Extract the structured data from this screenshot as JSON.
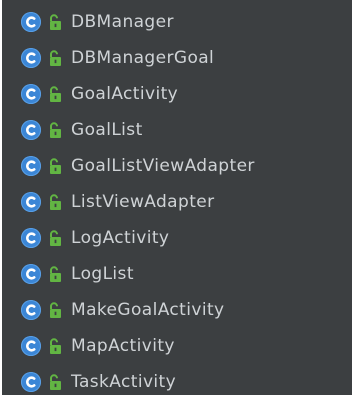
{
  "colors": {
    "panel_background": "#3c3f41",
    "class_icon": "#3b86d6",
    "lock_icon": "#62b543",
    "text": "#cfd3d6"
  },
  "icons": {
    "class": "class-icon",
    "access": "unlocked-icon"
  },
  "classes": [
    {
      "name": "DBManager"
    },
    {
      "name": "DBManagerGoal"
    },
    {
      "name": "GoalActivity"
    },
    {
      "name": "GoalList"
    },
    {
      "name": "GoalListViewAdapter"
    },
    {
      "name": "ListViewAdapter"
    },
    {
      "name": "LogActivity"
    },
    {
      "name": "LogList"
    },
    {
      "name": "MakeGoalActivity"
    },
    {
      "name": "MapActivity"
    },
    {
      "name": "TaskActivity"
    }
  ]
}
